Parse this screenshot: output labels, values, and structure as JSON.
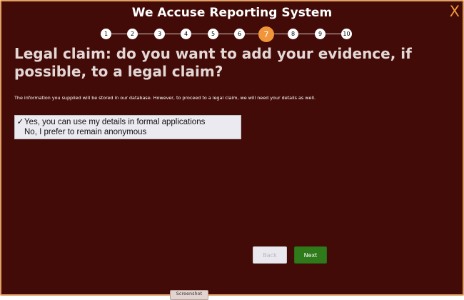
{
  "app": {
    "title": "We Accuse Reporting System",
    "close_label": "X"
  },
  "stepper": {
    "steps": [
      "1",
      "2",
      "3",
      "4",
      "5",
      "6",
      "7",
      "8",
      "9",
      "10"
    ],
    "current_step": "7"
  },
  "page": {
    "heading": "Legal claim: do you want to add your evidence, if possible, to a legal claim?",
    "info": "The information you supplied will be stored in our database. However, to proceed to a legal claim, we will need your details as well."
  },
  "options": [
    {
      "label": "Yes, you can use my details in formal applications",
      "selected": true
    },
    {
      "label": "No, I prefer to remain anonymous",
      "selected": false
    }
  ],
  "option_check_mark": "✓",
  "buttons": {
    "back": "Back",
    "next": "Next",
    "screenshot": "Screenshot"
  },
  "colors": {
    "background": "#420b07",
    "accent": "#f0953a",
    "next_button": "#2f7a1a"
  }
}
